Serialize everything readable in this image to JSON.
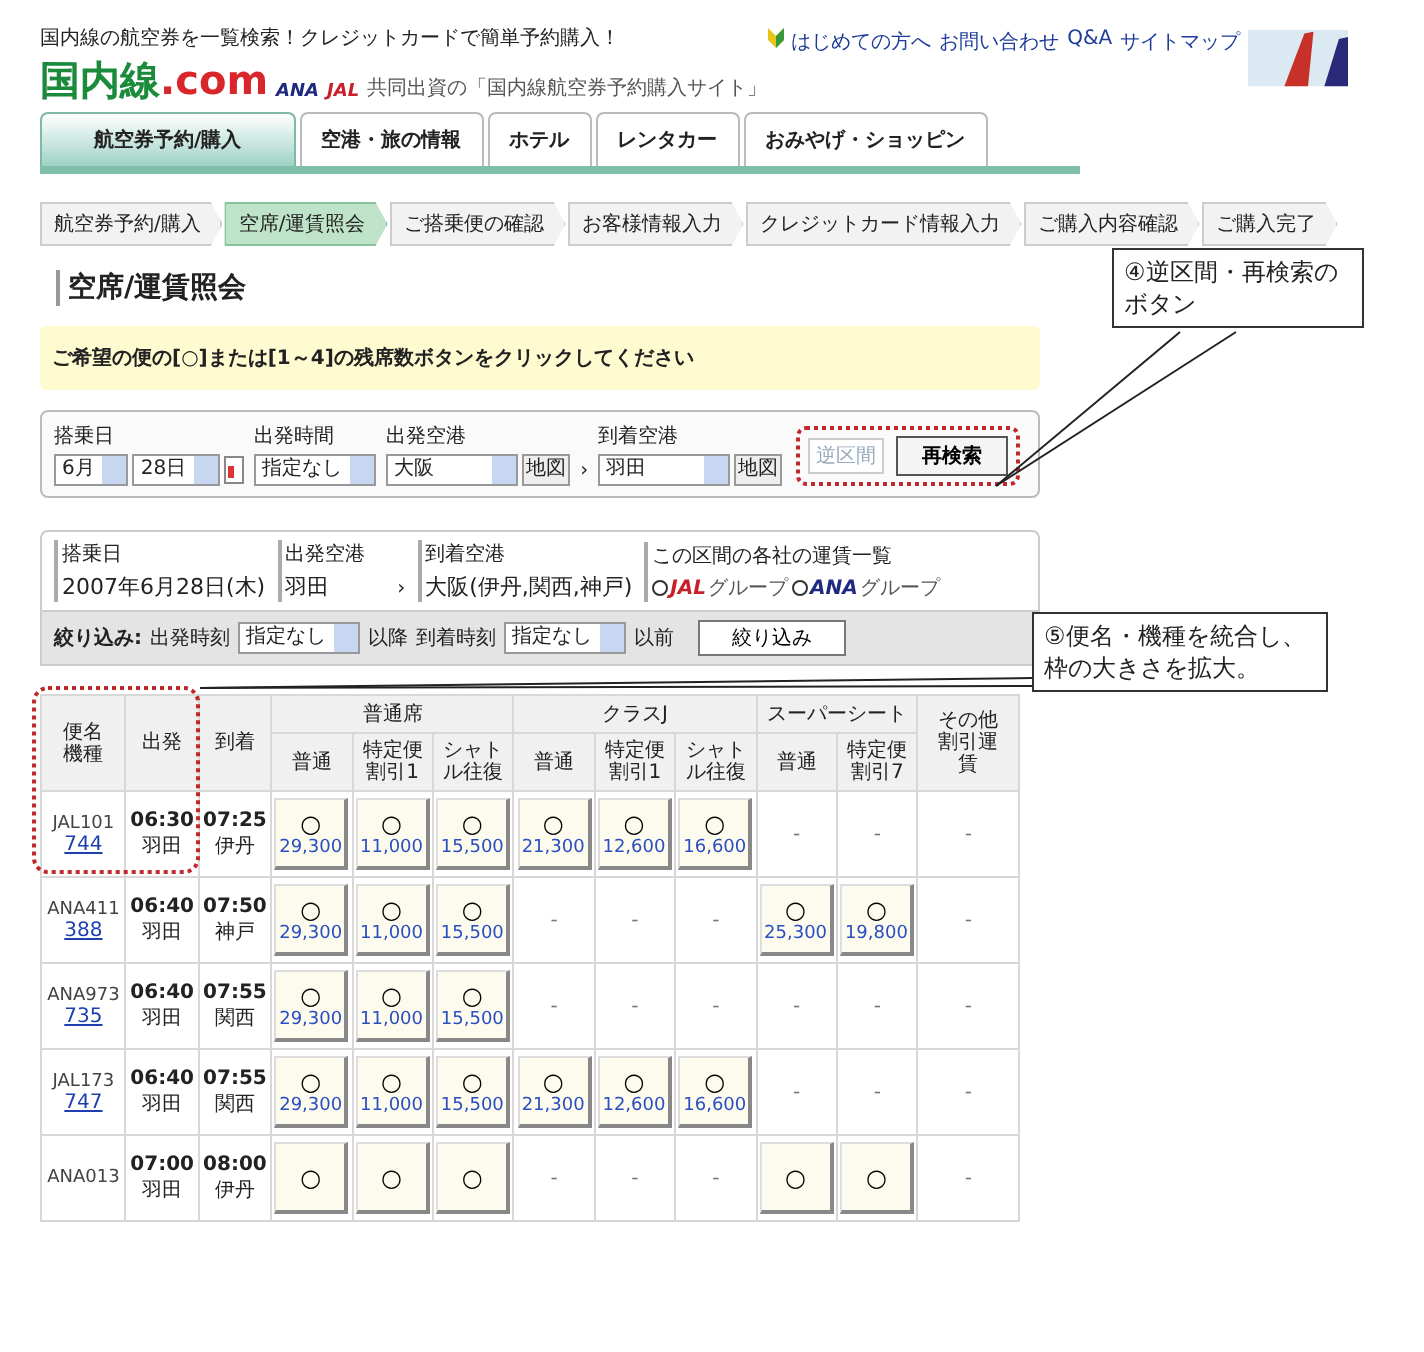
{
  "header": {
    "tagline": "国内線の航空券を一覧検索！クレジットカードで簡単予約購入！",
    "links": [
      "はじめての方へ",
      "お問い合わせ",
      "Q&A",
      "サイトマップ"
    ],
    "logo": {
      "main": "国内線",
      "suffix": ".com"
    },
    "partners": [
      "ANA",
      "JAL"
    ],
    "partner_note": "共同出資の「国内線航空券予約購入サイト」"
  },
  "tabs": [
    {
      "label": "航空券予約/購入",
      "selected": true
    },
    {
      "label": "空港・旅の情報",
      "selected": false
    },
    {
      "label": "ホテル",
      "selected": false
    },
    {
      "label": "レンタカー",
      "selected": false
    },
    {
      "label": "おみやげ・ショッピン",
      "selected": false
    }
  ],
  "steps": [
    {
      "label": "航空券予約/購入",
      "selected": false
    },
    {
      "label": "空席/運賃照会",
      "selected": true
    },
    {
      "label": "ご搭乗便の確認",
      "selected": false
    },
    {
      "label": "お客様情報入力",
      "selected": false
    },
    {
      "label": "クレジットカード情報入力",
      "selected": false
    },
    {
      "label": "ご購入内容確認",
      "selected": false
    },
    {
      "label": "ご購入完了",
      "selected": false
    }
  ],
  "page_title": "空席/運賃照会",
  "notice": "ご希望の便の[○]または[1～4]の残席数ボタンをクリックしてください",
  "search_form": {
    "date": {
      "label": "搭乗日",
      "month": "6月",
      "day": "28日"
    },
    "time": {
      "label": "出発時間",
      "value": "指定なし"
    },
    "departure": {
      "label": "出発空港",
      "value": "大阪",
      "map_button": "地図"
    },
    "separator": "›",
    "arrival": {
      "label": "到着空港",
      "value": "羽田",
      "map_button": "地図"
    },
    "reverse_button": {
      "label": "逆区間",
      "disabled": true
    },
    "search_button": "再検索"
  },
  "flight_info": {
    "date_label": "搭乗日",
    "date": "2007年6月28日(木)",
    "from_label": "出発空港",
    "from": "羽田",
    "arrow": "›",
    "to_label": "到着空港",
    "to": "大阪(伊丹,関西,神戸)",
    "fares_label": "この区間の各社の運賃一覧",
    "fare_links": [
      {
        "logo": "JAL",
        "text": "グループ"
      },
      {
        "logo": "ANA",
        "text": "グループ"
      }
    ]
  },
  "filter": {
    "label": "絞り込み:",
    "dep_label": "出発時刻",
    "dep_value": "指定なし",
    "dep_suffix": "以降",
    "arr_label": "到着時刻",
    "arr_value": "指定なし",
    "arr_suffix": "以前",
    "button": "絞り込み"
  },
  "table": {
    "flight_header": [
      "便名",
      "機種"
    ],
    "dep_header": "出発",
    "arr_header": "到着",
    "other_header": "その他割引運賃",
    "groups": [
      {
        "label": "普通席",
        "subs": [
          "普通",
          "特定便割引1",
          "シャトル往復"
        ]
      },
      {
        "label": "クラスJ",
        "subs": [
          "普通",
          "特定便割引1",
          "シャトル往復"
        ]
      },
      {
        "label": "スーパーシート",
        "subs": [
          "普通",
          "特定便割引7"
        ]
      }
    ],
    "rows": [
      {
        "flight": "JAL101",
        "aircraft": "744",
        "dep_time": "06:30",
        "dep_airport": "羽田",
        "arr_time": "07:25",
        "arr_airport": "伊丹",
        "other": "-",
        "fares": [
          {
            "kind": "seat",
            "mark": "○",
            "price": "29,300"
          },
          {
            "kind": "seat",
            "mark": "○",
            "price": "11,000"
          },
          {
            "kind": "seat",
            "mark": "○",
            "price": "15,500"
          },
          {
            "kind": "seat",
            "mark": "○",
            "price": "21,300"
          },
          {
            "kind": "seat",
            "mark": "○",
            "price": "12,600"
          },
          {
            "kind": "seat",
            "mark": "○",
            "price": "16,600"
          },
          {
            "kind": "none",
            "text": "-"
          },
          {
            "kind": "none",
            "text": "-"
          }
        ]
      },
      {
        "flight": "ANA411",
        "aircraft": "388",
        "dep_time": "06:40",
        "dep_airport": "羽田",
        "arr_time": "07:50",
        "arr_airport": "神戸",
        "other": "-",
        "fares": [
          {
            "kind": "seat",
            "mark": "○",
            "price": "29,300"
          },
          {
            "kind": "seat",
            "mark": "○",
            "price": "11,000"
          },
          {
            "kind": "seat",
            "mark": "○",
            "price": "15,500"
          },
          {
            "kind": "none",
            "text": "-"
          },
          {
            "kind": "none",
            "text": "-"
          },
          {
            "kind": "none",
            "text": "-"
          },
          {
            "kind": "seat",
            "mark": "○",
            "price": "25,300"
          },
          {
            "kind": "seat",
            "mark": "○",
            "price": "19,800"
          }
        ]
      },
      {
        "flight": "ANA973",
        "aircraft": "735",
        "dep_time": "06:40",
        "dep_airport": "羽田",
        "arr_time": "07:55",
        "arr_airport": "関西",
        "other": "-",
        "fares": [
          {
            "kind": "seat",
            "mark": "○",
            "price": "29,300"
          },
          {
            "kind": "seat",
            "mark": "○",
            "price": "11,000"
          },
          {
            "kind": "seat",
            "mark": "○",
            "price": "15,500"
          },
          {
            "kind": "none",
            "text": "-"
          },
          {
            "kind": "none",
            "text": "-"
          },
          {
            "kind": "none",
            "text": "-"
          },
          {
            "kind": "none",
            "text": "-"
          },
          {
            "kind": "none",
            "text": "-"
          }
        ]
      },
      {
        "flight": "JAL173",
        "aircraft": "747",
        "dep_time": "06:40",
        "dep_airport": "羽田",
        "arr_time": "07:55",
        "arr_airport": "関西",
        "other": "-",
        "fares": [
          {
            "kind": "seat",
            "mark": "○",
            "price": "29,300"
          },
          {
            "kind": "seat",
            "mark": "○",
            "price": "11,000"
          },
          {
            "kind": "seat",
            "mark": "○",
            "price": "15,500"
          },
          {
            "kind": "seat",
            "mark": "○",
            "price": "21,300"
          },
          {
            "kind": "seat",
            "mark": "○",
            "price": "12,600"
          },
          {
            "kind": "seat",
            "mark": "○",
            "price": "16,600"
          },
          {
            "kind": "none",
            "text": "-"
          },
          {
            "kind": "none",
            "text": "-"
          }
        ]
      },
      {
        "flight": "ANA013",
        "dep_time": "07:00",
        "dep_airport": "羽田",
        "arr_time": "08:00",
        "arr_airport": "伊丹",
        "other": "-",
        "fares": [
          {
            "kind": "seat",
            "mark": "○"
          },
          {
            "kind": "seat",
            "mark": "○"
          },
          {
            "kind": "seat",
            "mark": "○"
          },
          {
            "kind": "none",
            "text": "-"
          },
          {
            "kind": "none",
            "text": "-"
          },
          {
            "kind": "none",
            "text": "-"
          },
          {
            "kind": "seat",
            "mark": "○"
          },
          {
            "kind": "seat",
            "mark": "○"
          }
        ]
      }
    ]
  },
  "annotations": [
    {
      "text": "④逆区間・再検索のボタン"
    },
    {
      "text": "⑤便名・機種を統合し、枠の大きさを拡大。"
    }
  ]
}
